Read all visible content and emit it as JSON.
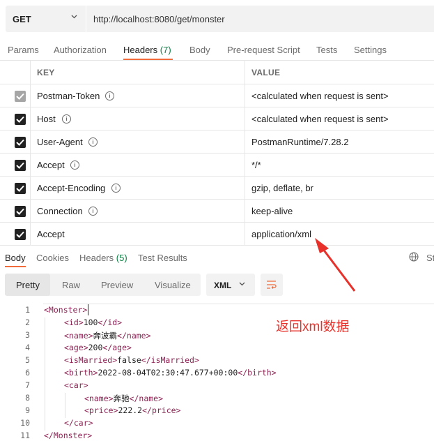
{
  "request": {
    "method": "GET",
    "url": "http://localhost:8080/get/monster"
  },
  "request_tabs": [
    {
      "label": "Params"
    },
    {
      "label": "Authorization"
    },
    {
      "label": "Headers",
      "count": "(7)",
      "active": true
    },
    {
      "label": "Body"
    },
    {
      "label": "Pre-request Script"
    },
    {
      "label": "Tests"
    },
    {
      "label": "Settings"
    }
  ],
  "headers_table": {
    "columns": [
      "KEY",
      "VALUE"
    ],
    "rows": [
      {
        "key": "Postman-Token",
        "value": "<calculated when request is sent>",
        "checked": true,
        "disabled": true,
        "info": true
      },
      {
        "key": "Host",
        "value": "<calculated when request is sent>",
        "checked": true,
        "info": true
      },
      {
        "key": "User-Agent",
        "value": "PostmanRuntime/7.28.2",
        "checked": true,
        "info": true
      },
      {
        "key": "Accept",
        "value": "*/*",
        "checked": true,
        "info": true
      },
      {
        "key": "Accept-Encoding",
        "value": "gzip, deflate, br",
        "checked": true,
        "info": true
      },
      {
        "key": "Connection",
        "value": "keep-alive",
        "checked": true,
        "info": true
      },
      {
        "key": "Accept",
        "value": "application/xml",
        "checked": true,
        "info": false
      }
    ]
  },
  "response_tabs": [
    {
      "label": "Body",
      "active": true
    },
    {
      "label": "Cookies"
    },
    {
      "label": "Headers",
      "count": "(5)"
    },
    {
      "label": "Test Results"
    }
  ],
  "status_cut": "St",
  "view_modes": [
    "Pretty",
    "Raw",
    "Preview",
    "Visualize"
  ],
  "active_view": "Pretty",
  "format": "XML",
  "code_lines": [
    {
      "n": "1",
      "indent": 0,
      "parts": [
        [
          "tag",
          "<Monster>"
        ]
      ]
    },
    {
      "n": "2",
      "indent": 1,
      "parts": [
        [
          "tag",
          "<id>"
        ],
        [
          "text",
          "100"
        ],
        [
          "tag",
          "</id>"
        ]
      ]
    },
    {
      "n": "3",
      "indent": 1,
      "parts": [
        [
          "tag",
          "<name>"
        ],
        [
          "text",
          "奔波霸"
        ],
        [
          "tag",
          "</name>"
        ]
      ]
    },
    {
      "n": "4",
      "indent": 1,
      "parts": [
        [
          "tag",
          "<age>"
        ],
        [
          "text",
          "200"
        ],
        [
          "tag",
          "</age>"
        ]
      ]
    },
    {
      "n": "5",
      "indent": 1,
      "parts": [
        [
          "tag",
          "<isMarried>"
        ],
        [
          "text",
          "false"
        ],
        [
          "tag",
          "</isMarried>"
        ]
      ]
    },
    {
      "n": "6",
      "indent": 1,
      "parts": [
        [
          "tag",
          "<birth>"
        ],
        [
          "text",
          "2022-08-04T02:30:47.677+00:00"
        ],
        [
          "tag",
          "</birth>"
        ]
      ]
    },
    {
      "n": "7",
      "indent": 1,
      "parts": [
        [
          "tag",
          "<car>"
        ]
      ]
    },
    {
      "n": "8",
      "indent": 2,
      "parts": [
        [
          "tag",
          "<name>"
        ],
        [
          "text",
          "奔驰"
        ],
        [
          "tag",
          "</name>"
        ]
      ]
    },
    {
      "n": "9",
      "indent": 2,
      "parts": [
        [
          "tag",
          "<price>"
        ],
        [
          "text",
          "222.2"
        ],
        [
          "tag",
          "</price>"
        ]
      ]
    },
    {
      "n": "10",
      "indent": 1,
      "parts": [
        [
          "tag",
          "</car>"
        ]
      ]
    },
    {
      "n": "11",
      "indent": 0,
      "parts": [
        [
          "tag",
          "</Monster>"
        ]
      ]
    }
  ],
  "annotation": "返回xml数据",
  "colors": {
    "accent": "#f26b3a",
    "count": "#0b8043",
    "tag": "#8b2252",
    "annotation": "#e8312a"
  }
}
